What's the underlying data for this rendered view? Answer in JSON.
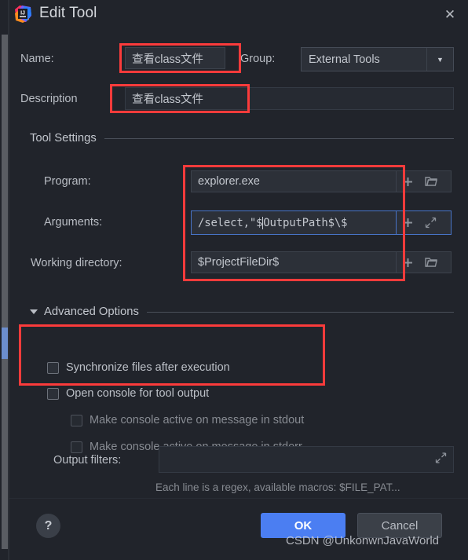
{
  "window": {
    "title": "Edit Tool",
    "app_icon": "intellij-idea-icon",
    "close_icon": "✕"
  },
  "form": {
    "name_label": "Name:",
    "name_value": "查看class文件",
    "group_label": "Group:",
    "group_value": "External Tools",
    "group_options": [
      "External Tools"
    ],
    "description_label": "Description",
    "description_value": "查看class文件"
  },
  "tool_settings": {
    "header": "Tool Settings",
    "program_label": "Program:",
    "program_value": "explorer.exe",
    "arguments_label": "Arguments:",
    "arguments_value_before_caret": "/select,\"$",
    "arguments_value_after_caret": "OutputPath$\\$",
    "arguments_value_full": "/select,\"$OutputPath$\\$",
    "working_directory_label": "Working directory:",
    "working_directory_value": "$ProjectFileDir$",
    "insert_macro_icon": "plus-icon",
    "browse_icon": "folder-icon",
    "expand_icon": "expand-arrows-icon"
  },
  "advanced_options": {
    "header": "Advanced Options",
    "checkboxes": [
      {
        "label": "Synchronize files after execution",
        "checked": false,
        "disabled": false
      },
      {
        "label": "Open console for tool output",
        "checked": false,
        "disabled": false
      },
      {
        "label": "Make console active on message in stdout",
        "checked": false,
        "disabled": true
      },
      {
        "label": "Make console active on message in stderr",
        "checked": false,
        "disabled": true
      }
    ],
    "output_filters_label": "Output filters:",
    "output_filters_value": "",
    "output_filters_hint": "Each line is a regex, available macros: $FILE_PAT..."
  },
  "footer": {
    "help_label": "?",
    "ok_label": "OK",
    "cancel_label": "Cancel"
  },
  "watermark": "CSDN @UnkonwnJavaWorld",
  "colors": {
    "dialog_background": "#21242b",
    "field_background": "#2c3038",
    "accent_blue": "#4b7ef2",
    "focus_border": "#4874c8",
    "annotation_red": "#fb3b3b",
    "text_primary": "#c3c7ce",
    "text_muted": "#878b92",
    "scrollbar_thumb": "#6c8ece"
  }
}
